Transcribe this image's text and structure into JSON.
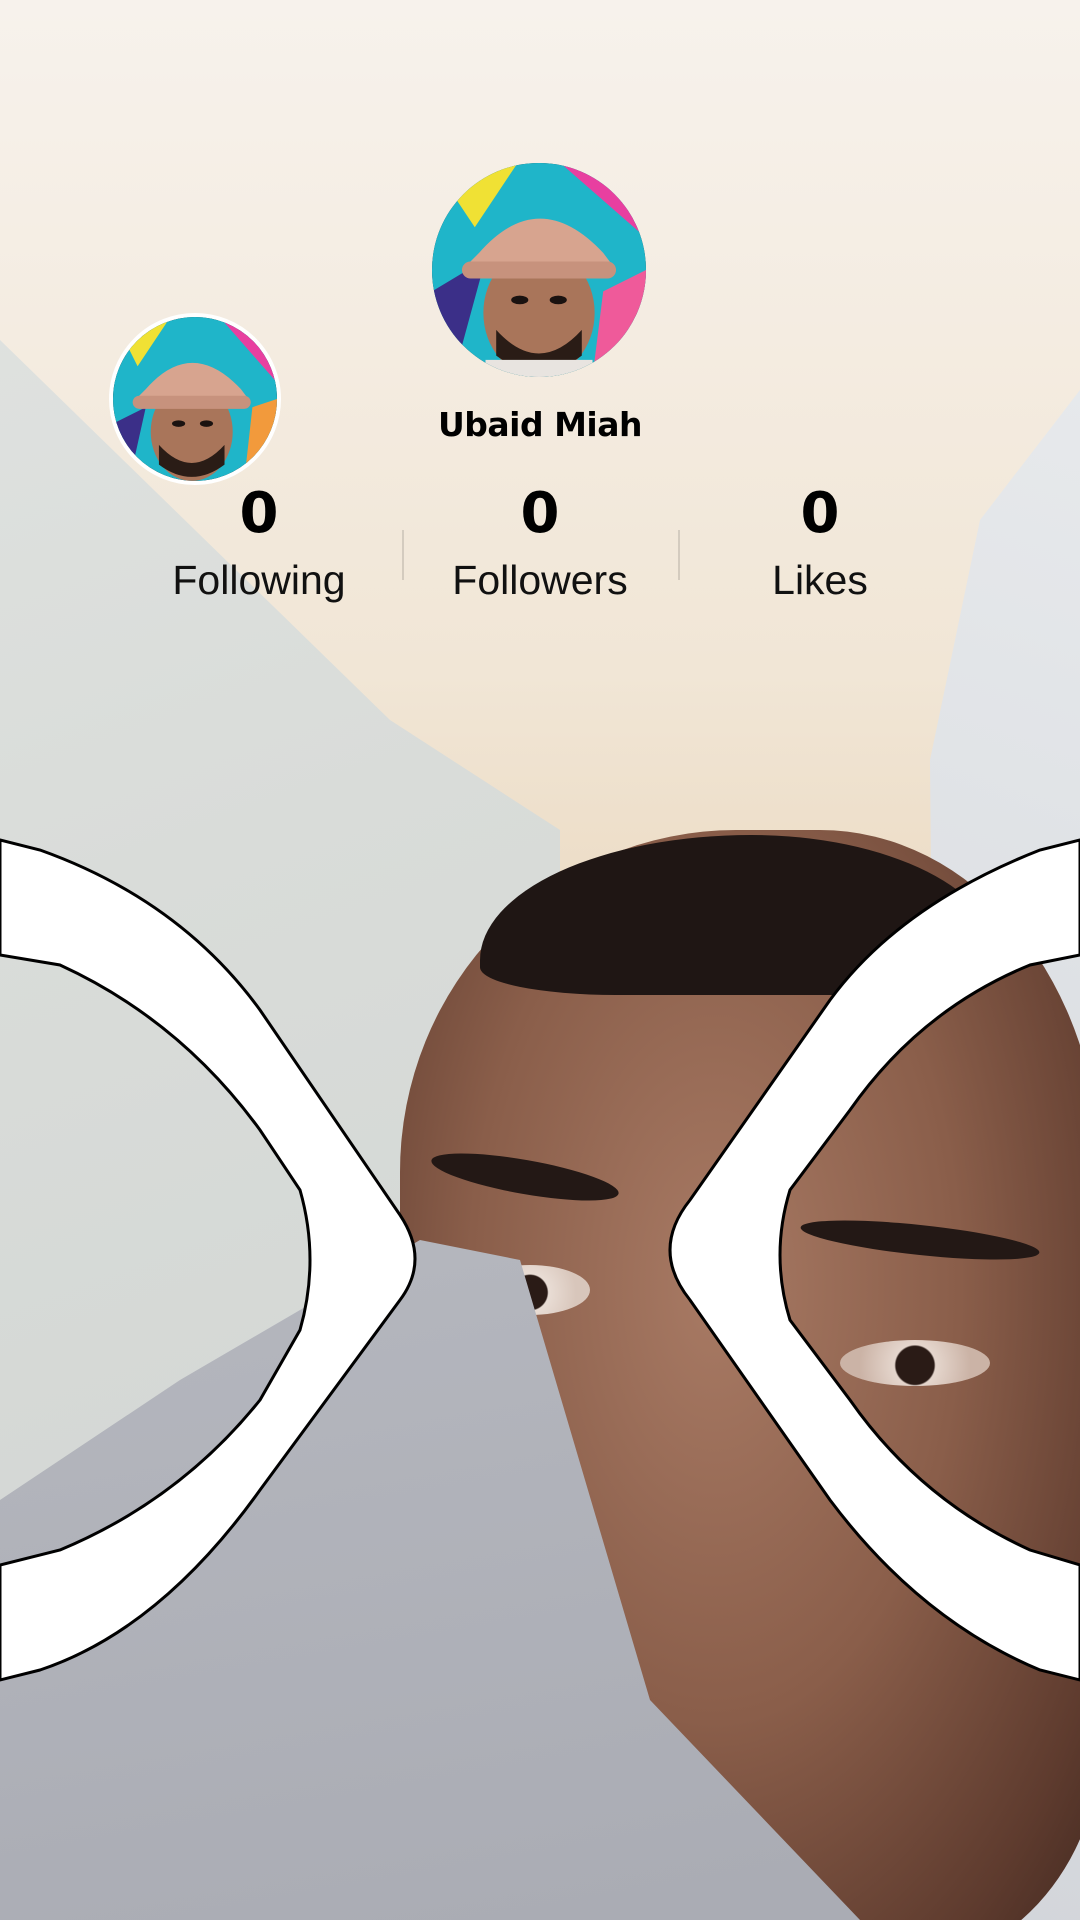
{
  "profile": {
    "username": "Ubaid Miah",
    "stats": [
      {
        "value": "0",
        "label": "Following"
      },
      {
        "value": "0",
        "label": "Followers"
      },
      {
        "value": "0",
        "label": "Likes"
      }
    ]
  },
  "overlay": {
    "frame_color": "#ffffff",
    "frame_outline_color": "#000000"
  }
}
